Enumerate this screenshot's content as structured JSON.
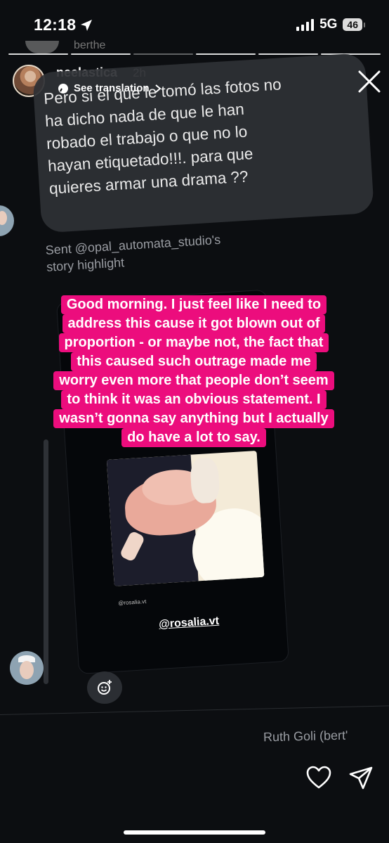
{
  "status_bar": {
    "time": "12:18",
    "network": "5G",
    "battery": "46"
  },
  "previous_reply_name": "berthe",
  "post": {
    "author": "neelastica",
    "time_ago": "2h",
    "translate_label": "See translation"
  },
  "message": {
    "lines": [
      "Pero si el que le tomó las fotos no",
      "ha dicho nada de que le han",
      "robado el trabajo o que no lo",
      "hayan etiquetado!!!. para que",
      "quieres armar una drama ??"
    ]
  },
  "shared": {
    "caption_lines": [
      "Sent @opal_automata_studio's",
      "story highlight"
    ],
    "overlay_lines": [
      "Good morning. I just feel like I need to",
      "address this cause it got blown out of",
      "proportion - or maybe not, the fact that",
      "this caused such outrage made me",
      "worry even more that people don’t seem",
      "to think it was an obvious statement. I",
      "wasn’t gonna say anything but I actually",
      "do have a lot to say."
    ],
    "small_tag": "@rosalia.vt",
    "tag": "@rosalia.vt"
  },
  "reply": {
    "name": "Ruth Goli (bert'"
  },
  "icons": {
    "close": "close-icon",
    "like": "heart-icon",
    "share": "send-icon",
    "react": "add-reaction-icon",
    "location": "location-arrow-icon"
  },
  "colors": {
    "background": "#0c0e11",
    "bubble": "#2e3035",
    "highlight": "#ec0d7d"
  }
}
